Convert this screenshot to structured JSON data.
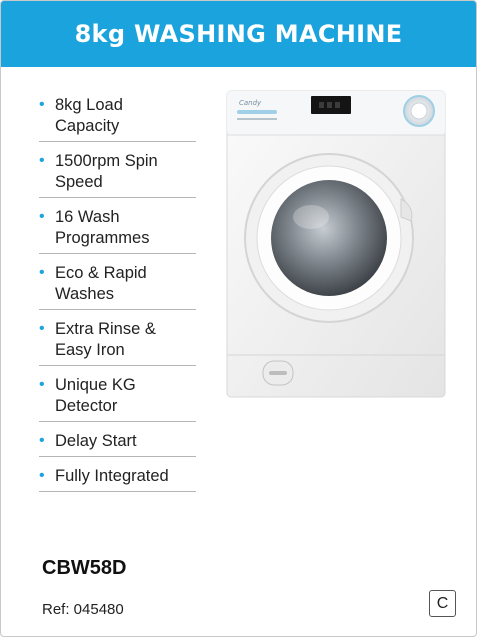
{
  "header": {
    "title": "8kg WASHING MACHINE"
  },
  "features": [
    {
      "line1": "8kg Load",
      "line2": "Capacity"
    },
    {
      "line1": "1500rpm Spin",
      "line2": "Speed"
    },
    {
      "line1": "16 Wash",
      "line2": "Programmes"
    },
    {
      "line1": "Eco & Rapid",
      "line2": "Washes"
    },
    {
      "line1": "Extra Rinse &",
      "line2": "Easy Iron"
    },
    {
      "line1": "Unique KG",
      "line2": "Detector"
    },
    {
      "line1": "Delay Start",
      "line2": ""
    },
    {
      "line1": "Fully Integrated",
      "line2": ""
    }
  ],
  "product": {
    "model": "CBW58D",
    "ref": "Ref: 045480",
    "energy_class": "C",
    "brand_mark": "Candy"
  },
  "colors": {
    "accent": "#1ba3dd"
  }
}
